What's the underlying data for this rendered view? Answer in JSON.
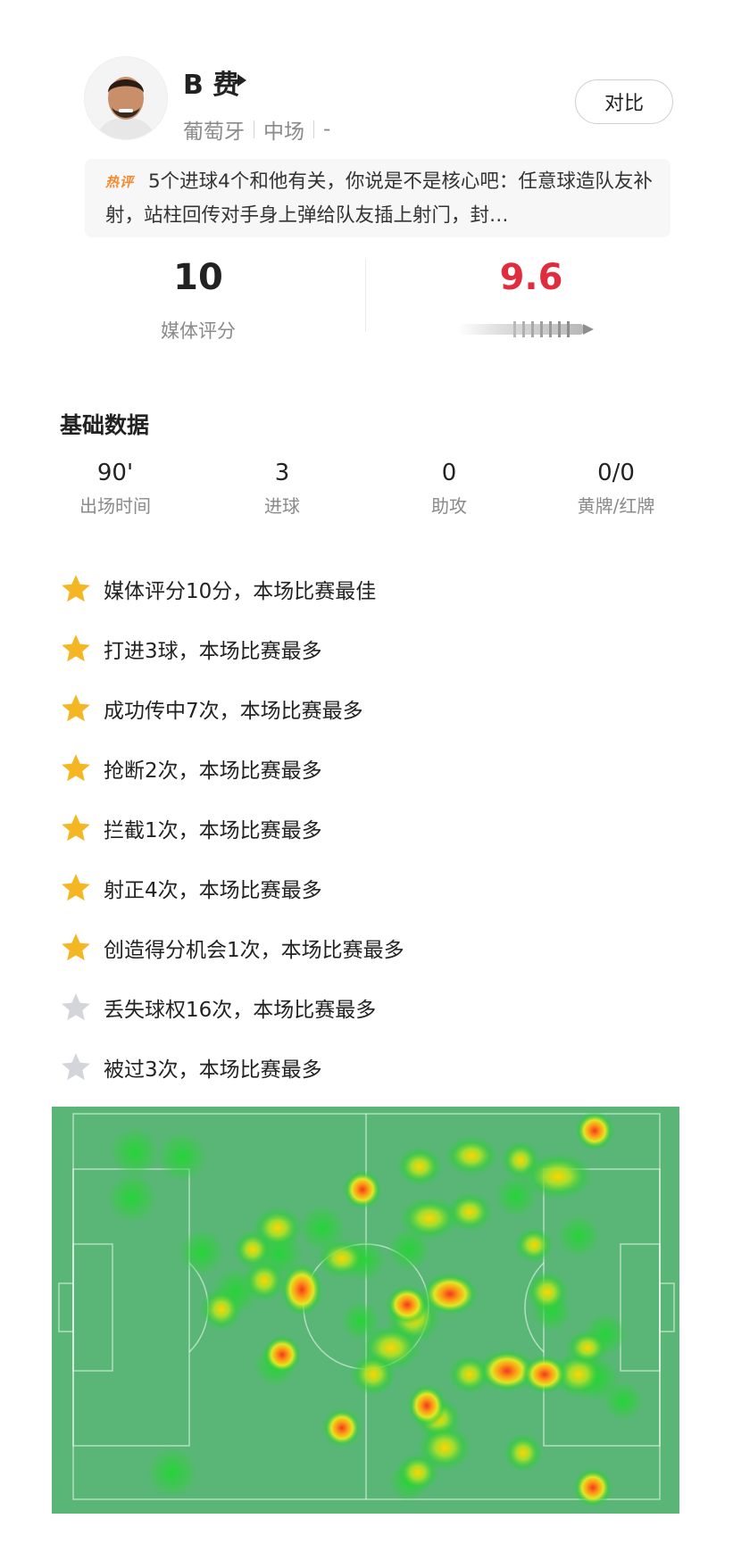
{
  "player": {
    "name": "B 费",
    "country": "葡萄牙",
    "position": "中场",
    "number": "-"
  },
  "compare_label": "对比",
  "hot_comment": {
    "tag": "热评",
    "text": "5个进球4个和他有关，你说是不是核心吧：任意球造队友补射，站柱回传对手身上弹给队友插上射门，封…"
  },
  "ratings": {
    "media_value": "10",
    "media_label": "媒体评分",
    "score_value": "9.6"
  },
  "basic": {
    "title": "基础数据",
    "stats": [
      {
        "value": "90'",
        "label": "出场时间"
      },
      {
        "value": "3",
        "label": "进球"
      },
      {
        "value": "0",
        "label": "助攻"
      },
      {
        "value": "0/0",
        "label": "黄牌/红牌"
      }
    ]
  },
  "highlights": [
    {
      "text": "媒体评分10分，本场比赛最佳",
      "star": "gold"
    },
    {
      "text": "打进3球，本场比赛最多",
      "star": "gold"
    },
    {
      "text": "成功传中7次，本场比赛最多",
      "star": "gold"
    },
    {
      "text": "抢断2次，本场比赛最多",
      "star": "gold"
    },
    {
      "text": "拦截1次，本场比赛最多",
      "star": "gold"
    },
    {
      "text": "射正4次，本场比赛最多",
      "star": "gold"
    },
    {
      "text": "创造得分机会1次，本场比赛最多",
      "star": "gold"
    },
    {
      "text": "丢失球权16次，本场比赛最多",
      "star": "silver"
    },
    {
      "text": "被过3次，本场比赛最多",
      "star": "silver"
    }
  ],
  "colors": {
    "accent_red": "#e02c3c",
    "hot_orange": "#f4892d",
    "pitch_green": "#59b676",
    "star_gold": "#f5b623",
    "star_silver": "#d3d5db"
  }
}
